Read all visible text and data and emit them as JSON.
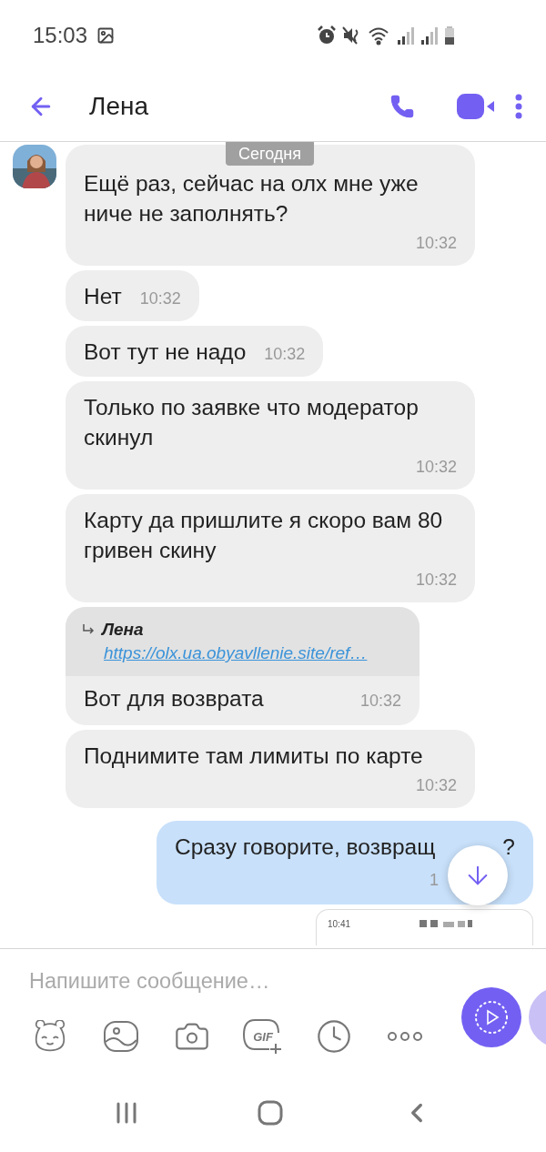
{
  "status_bar": {
    "time": "15:03"
  },
  "header": {
    "title": "Лена"
  },
  "date_chip": "Сегодня",
  "messages": [
    {
      "kind": "incoming",
      "avatar": true,
      "text": "Ещё раз, сейчас на олх мне уже ниче не заполнять?",
      "time": "10:32"
    },
    {
      "kind": "incoming",
      "avatar": false,
      "text": "Нет",
      "time": "10:32"
    },
    {
      "kind": "incoming",
      "avatar": false,
      "text": "Вот тут не надо",
      "time": "10:32"
    },
    {
      "kind": "incoming",
      "avatar": false,
      "text": "Только по заявке что модератор скинул",
      "time": "10:32"
    },
    {
      "kind": "incoming",
      "avatar": false,
      "text": "Карту да пришлите я скоро вам 80 гривен скину",
      "time": "10:32"
    },
    {
      "kind": "reply",
      "avatar": false,
      "quote_author": "Лена",
      "quote_link": "https://olx.ua.obyavllenie.site/ref…",
      "text": "Вот для возврата",
      "time": "10:32"
    },
    {
      "kind": "incoming",
      "avatar": false,
      "text": "Поднимите там лимиты по карте",
      "time": "10:32"
    },
    {
      "kind": "outgoing",
      "text": "Сразу говорите, возвращ",
      "text_end": "?",
      "time": "1"
    },
    {
      "kind": "image",
      "time": "10:41"
    }
  ],
  "composer": {
    "placeholder": "Напишите сообщение…",
    "gif_label": "GIF"
  }
}
